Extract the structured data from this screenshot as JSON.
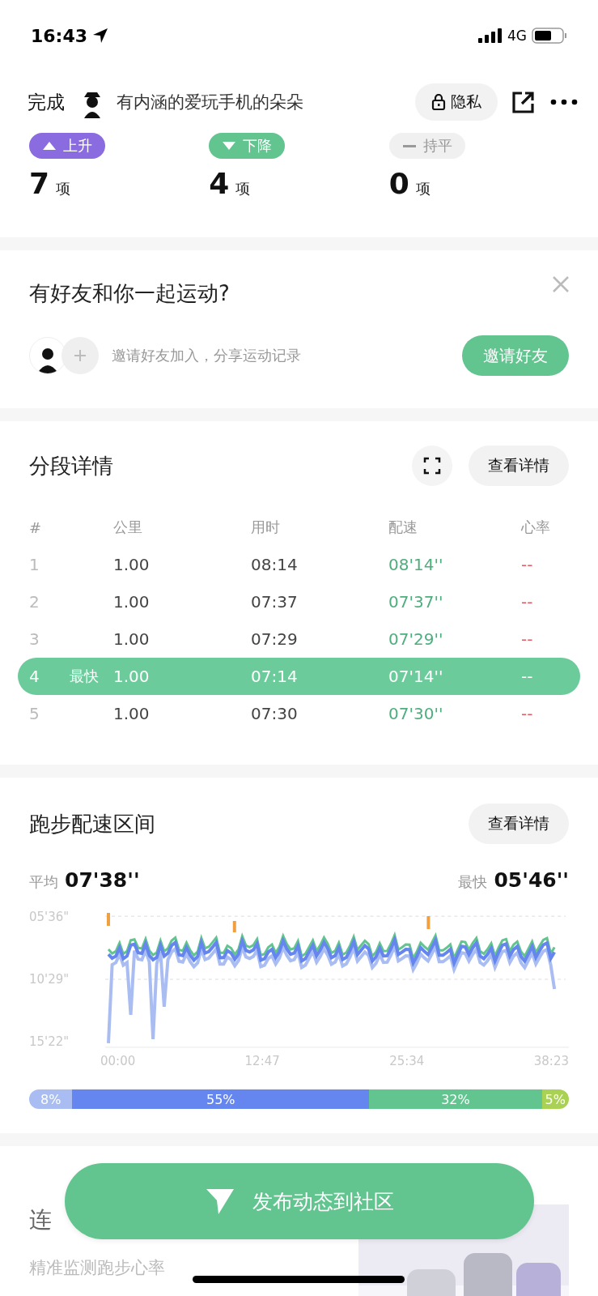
{
  "status_bar": {
    "time": "16:43",
    "network": "4G"
  },
  "nav": {
    "done": "完成",
    "user_name": "有内涵的爱玩手机的朵朵",
    "privacy": "隐私"
  },
  "trends": [
    {
      "kind": "up",
      "label": "上升",
      "count": "7",
      "unit": "项"
    },
    {
      "kind": "down",
      "label": "下降",
      "count": "4",
      "unit": "项"
    },
    {
      "kind": "flat",
      "label": "持平",
      "count": "0",
      "unit": "项"
    }
  ],
  "friends_card": {
    "title": "有好友和你一起运动?",
    "hint": "邀请好友加入，分享运动记录",
    "button": "邀请好友"
  },
  "splits": {
    "title": "分段详情",
    "details_button": "查看详情",
    "columns": [
      "#",
      "公里",
      "用时",
      "配速",
      "心率"
    ],
    "rows": [
      {
        "index": "1",
        "km": "1.00",
        "time": "08:14",
        "pace": "08'14''",
        "heart_rate": "--",
        "selected": false
      },
      {
        "index": "2",
        "km": "1.00",
        "time": "07:37",
        "pace": "07'37''",
        "heart_rate": "--",
        "selected": false
      },
      {
        "index": "3",
        "km": "1.00",
        "time": "07:29",
        "pace": "07'29''",
        "heart_rate": "--",
        "selected": false
      },
      {
        "index": "4",
        "badge": "最快",
        "km": "1.00",
        "time": "07:14",
        "pace": "07'14''",
        "heart_rate": "--",
        "selected": true
      },
      {
        "index": "5",
        "km": "1.00",
        "time": "07:30",
        "pace": "07'30''",
        "heart_rate": "--",
        "selected": false
      }
    ]
  },
  "pace_zones": {
    "title": "跑步配速区间",
    "details_button": "查看详情",
    "average_label": "平均",
    "average": "07'38''",
    "fastest_label": "最快",
    "fastest": "05'46''",
    "y_labels": [
      "05'36\"",
      "10'29\"",
      "15'22\""
    ],
    "x_labels": [
      "00:00",
      "12:47",
      "25:34",
      "38:23"
    ],
    "zones": [
      {
        "label": "8%",
        "color": "#a9bdf3"
      },
      {
        "label": "55%",
        "color": "#6486ee"
      },
      {
        "label": "32%",
        "color": "#62c48f"
      },
      {
        "label": "5%",
        "color": "#a9d255"
      }
    ]
  },
  "device_promo": {
    "title": "连",
    "lines": [
      "精准监测跑步心率"
    ]
  },
  "publish_button": "发布动态到社区"
}
